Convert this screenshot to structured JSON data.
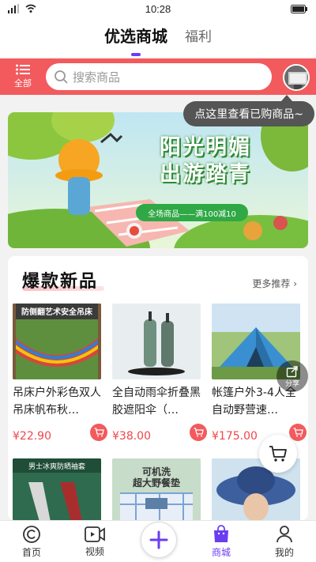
{
  "status_bar": {
    "time": "10:28"
  },
  "top_tabs": [
    {
      "label": "优选商城",
      "active": true
    },
    {
      "label": "福利",
      "active": false
    }
  ],
  "search": {
    "all_label": "全部",
    "placeholder": "搜索商品"
  },
  "tooltip": "点这里查看已购商品~",
  "banner": {
    "title_line1": "阳光明媚",
    "title_line2": "出游踏青",
    "subtitle": "全场商品——满100减10"
  },
  "section": {
    "title": "爆款新品",
    "more": "更多推荐"
  },
  "products": [
    {
      "name": "吊床户外彩色双人吊床帆布秋…",
      "price": "¥22.90",
      "image_text": "防侧翻艺术安全吊床"
    },
    {
      "name": "全自动雨伞折叠黑胶遮阳伞（…",
      "price": "¥38.00"
    },
    {
      "name": "帐篷户外3-4人全自动野营速…",
      "price": "¥175.00"
    }
  ],
  "products_row2": [
    {
      "image_text": "男士冰爽防晒袖套"
    },
    {
      "image_text_line1": "可机洗",
      "image_text_line2": "超大野餐垫"
    },
    {
      "image_text": ""
    }
  ],
  "share_label": "分享",
  "bottom_nav": [
    {
      "label": "首页",
      "icon": "home-icon",
      "active": false
    },
    {
      "label": "视频",
      "icon": "video-icon",
      "active": false
    },
    {
      "label": "",
      "icon": "plus-icon",
      "active": false
    },
    {
      "label": "商城",
      "icon": "shop-bag-icon",
      "active": true
    },
    {
      "label": "我的",
      "icon": "user-icon",
      "active": false
    }
  ],
  "colors": {
    "accent": "#f25a5d",
    "brand_purple": "#6a3df0",
    "price": "#f2454a"
  }
}
